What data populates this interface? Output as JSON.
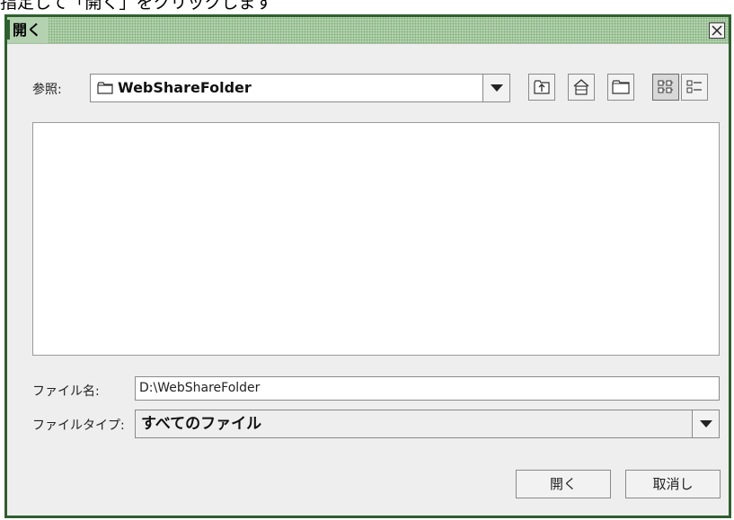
{
  "caption": "指定して「開く」をクリックします",
  "dialog": {
    "title": "開く",
    "look_in": {
      "label": "参照:",
      "value": "WebShareFolder"
    },
    "toolbar": {
      "icons": [
        "up-one-level-icon",
        "home-icon",
        "new-folder-icon",
        "list-view-icon",
        "details-view-icon"
      ]
    },
    "file_name": {
      "label": "ファイル名:",
      "value": "D:\\WebShareFolder"
    },
    "file_type": {
      "label": "ファイルタイプ:",
      "value": "すべてのファイル"
    },
    "buttons": {
      "open": "開く",
      "cancel": "取消し"
    }
  },
  "colors": {
    "title_border": "#2f5f2f",
    "title_pattern": "#b4d2b0",
    "dialog_bg": "#eeeeee"
  }
}
